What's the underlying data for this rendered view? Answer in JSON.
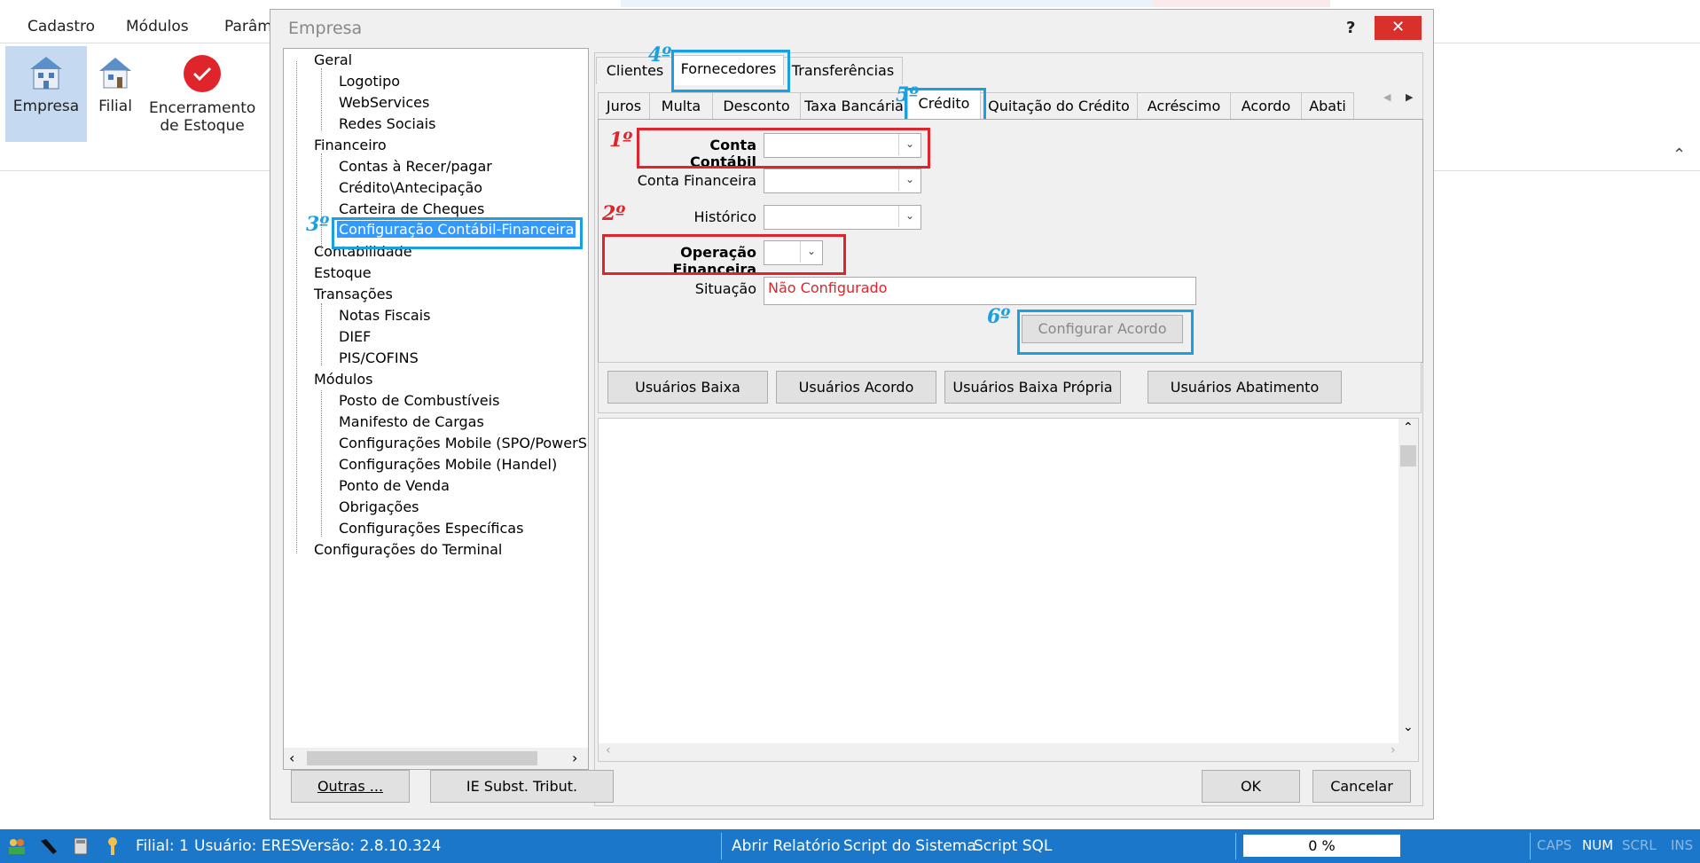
{
  "menu": {
    "cadastro": "Cadastro",
    "modulos": "Módulos",
    "param": "Parâm"
  },
  "ribbon": {
    "empresa": "Empresa",
    "filial": "Filial",
    "encerramento_l1": "Encerramento",
    "encerramento_l2": "de Estoque"
  },
  "dialog": {
    "title": "Empresa",
    "help": "?",
    "close": "✕",
    "tree": {
      "geral": "Geral",
      "logotipo": "Logotipo",
      "webservices": "WebServices",
      "redes": "Redes Sociais",
      "financeiro": "Financeiro",
      "contas": "Contas à Recer/pagar",
      "credito": "Crédito\\Antecipação",
      "carteira": "Carteira de Cheques",
      "config_contabil": "Configuração Contábil-Financeira",
      "contabilidade": "Contabilidade",
      "estoque": "Estoque",
      "transacoes": "Transações",
      "notas": "Notas Fiscais",
      "dief": "DIEF",
      "pis": "PIS/COFINS",
      "modulos": "Módulos",
      "posto": "Posto de Combustíveis",
      "manifesto": "Manifesto de Cargas",
      "mobile_spo": "Configurações Mobile (SPO/PowerSa",
      "mobile_handel": "Configurações Mobile (Handel)",
      "ponto": "Ponto de Venda",
      "obrigacoes": "Obrigações",
      "especificas": "Configurações Específicas",
      "terminal": "Configurações do Terminal"
    },
    "tabs_top": {
      "clientes": "Clientes",
      "fornecedores": "Fornecedores",
      "transferencias": "Transferências"
    },
    "tabs_sub": {
      "juros": "Juros",
      "multa": "Multa",
      "desconto": "Desconto",
      "taxa": "Taxa Bancária",
      "credito": "Crédito",
      "quitacao": "Quitação do Crédito",
      "acrescimo": "Acréscimo",
      "acordo": "Acordo",
      "abati": "Abati"
    },
    "form": {
      "conta_contabil": "Conta Contábil",
      "conta_financeira": "Conta Financeira",
      "historico": "Histórico",
      "operacao": "Operação Financeira",
      "situacao": "Situação",
      "situacao_value": "Não Configurado",
      "configurar_acordo": "Configurar Acordo"
    },
    "user_buttons": {
      "baixa": "Usuários Baixa",
      "acordo": "Usuários Acordo",
      "baixa_propria": "Usuários Baixa Própria",
      "abatimento": "Usuários Abatimento"
    },
    "bottom": {
      "outras": "Outras ...",
      "ie": "IE Subst. Tribut.",
      "ok": "OK",
      "cancelar": "Cancelar"
    },
    "annotations": {
      "n1": "1º",
      "n2": "2º",
      "n3": "3º",
      "n4": "4º",
      "n5": "5º",
      "n6": "6º"
    }
  },
  "status": {
    "filial": "Filial: 1",
    "usuario": "Usuário: ERES",
    "versao": "Versão: 2.8.10.324",
    "abrir": "Abrir Relatório",
    "script_sistema": "Script do Sistema",
    "script_sql": "Script SQL",
    "progress": "0 %",
    "caps": "CAPS",
    "num": "NUM",
    "scrl": "SCRL",
    "ins": "INS"
  },
  "colors": {
    "status_bg": "#1a77c9",
    "annotation_red": "#e0242c",
    "annotation_blue": "#1aa0e0",
    "close_red": "#d9302c"
  }
}
